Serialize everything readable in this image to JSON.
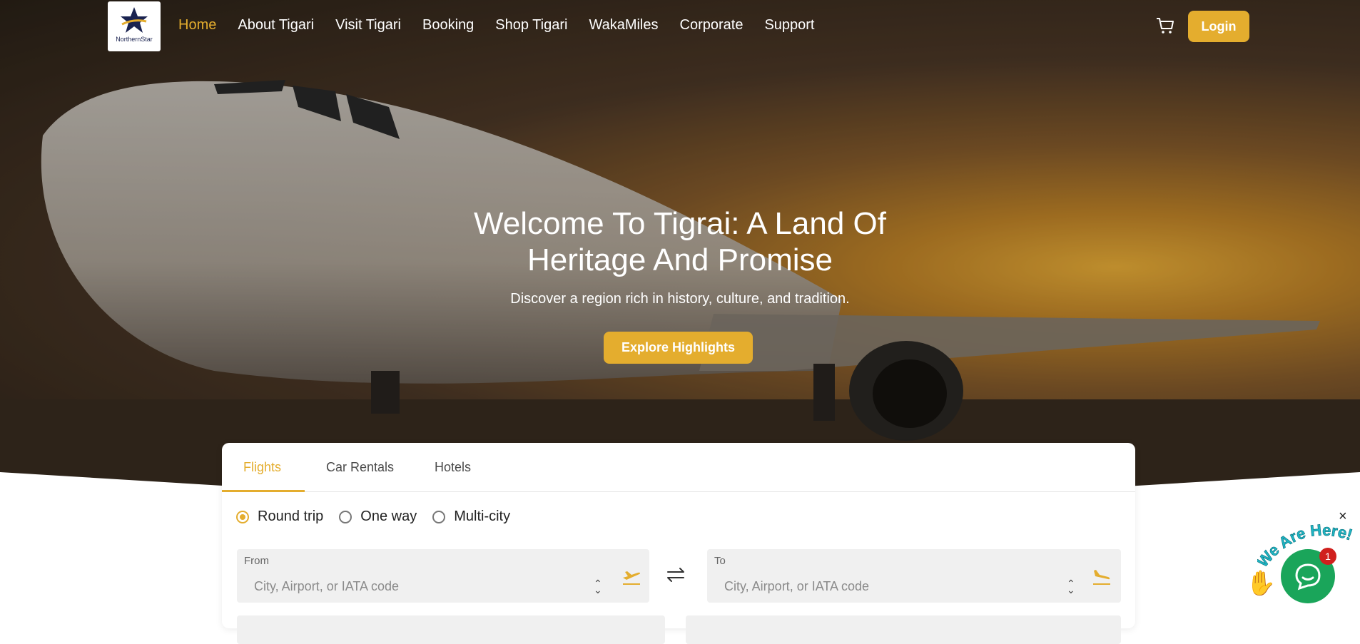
{
  "brand": {
    "logo_text": "NorthernStar"
  },
  "nav": {
    "items": [
      {
        "label": "Home",
        "active": true
      },
      {
        "label": "About Tigari",
        "active": false
      },
      {
        "label": "Visit Tigari",
        "active": false
      },
      {
        "label": "Booking",
        "active": false
      },
      {
        "label": "Shop Tigari",
        "active": false
      },
      {
        "label": "WakaMiles",
        "active": false
      },
      {
        "label": "Corporate",
        "active": false
      },
      {
        "label": "Support",
        "active": false
      }
    ],
    "cart_icon": "cart-icon",
    "login_label": "Login"
  },
  "hero": {
    "title": "Welcome To Tigrai: A Land Of Heritage And Promise",
    "subtitle": "Discover a region rich in history, culture, and tradition.",
    "cta_label": "Explore Highlights"
  },
  "booking": {
    "tabs": [
      "Flights",
      "Car Rentals",
      "Hotels"
    ],
    "active_tab": "Flights",
    "trip_types": [
      "Round trip",
      "One way",
      "Multi-city"
    ],
    "selected_trip_type": "Round trip",
    "from": {
      "label": "From",
      "placeholder": "City, Airport, or IATA code"
    },
    "to": {
      "label": "To",
      "placeholder": "City, Airport, or IATA code"
    }
  },
  "chat_widget": {
    "tagline": "We Are Here!",
    "badge_count": "1",
    "close_glyph": "×"
  },
  "colors": {
    "accent": "#e4ad2e",
    "chat": "#1aa55a",
    "badge": "#d0201d"
  }
}
